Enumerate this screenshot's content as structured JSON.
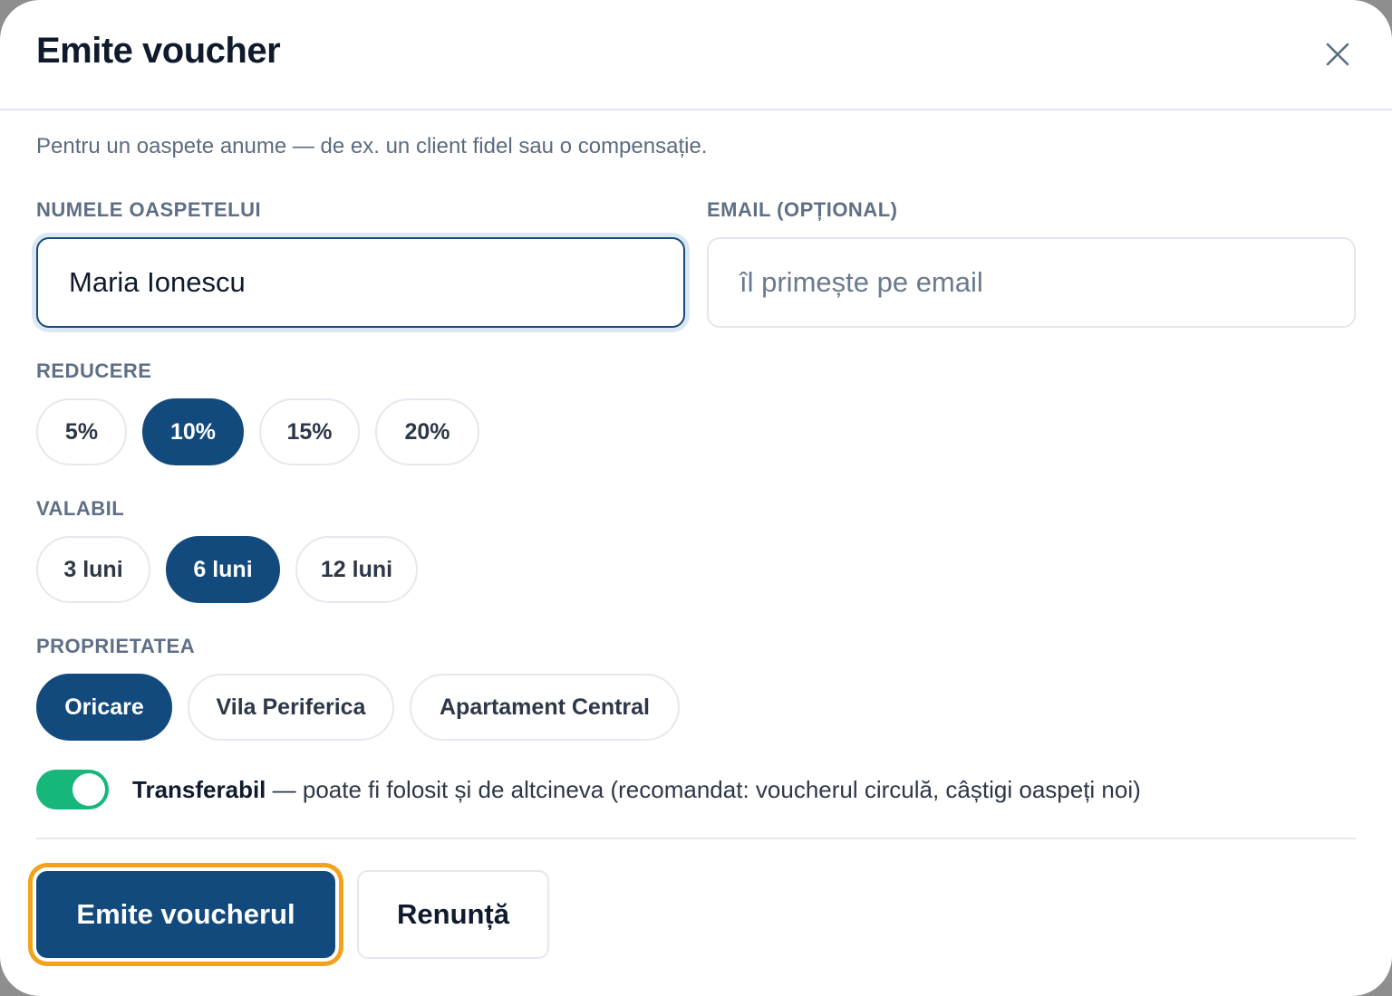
{
  "dialog": {
    "title": "Emite voucher",
    "subtitle": "Pentru un oaspete anume — de ex. un client fidel sau o compensație."
  },
  "fields": {
    "guest_name": {
      "label": "NUMELE OASPETELUI",
      "value": "Maria Ionescu"
    },
    "email": {
      "label": "EMAIL (OPȚIONAL)",
      "value": "",
      "placeholder": "îl primește pe email"
    }
  },
  "discount": {
    "label": "REDUCERE",
    "options": [
      "5%",
      "10%",
      "15%",
      "20%"
    ],
    "selected": "10%"
  },
  "validity": {
    "label": "VALABIL",
    "options": [
      "3 luni",
      "6 luni",
      "12 luni"
    ],
    "selected": "6 luni"
  },
  "property": {
    "label": "PROPRIETATEA",
    "options": [
      "Oricare",
      "Vila Periferica",
      "Apartament Central"
    ],
    "selected": "Oricare"
  },
  "transferable": {
    "enabled": true,
    "title": "Transferabil",
    "description": " — poate fi folosit și de altcineva (recomandat: voucherul circulă, câștigi oaspeți noi)"
  },
  "actions": {
    "primary_label": "Emite voucherul",
    "secondary_label": "Renunță"
  },
  "colors": {
    "primary": "#124a7d",
    "toggle_on": "#17b67b",
    "focus_ring": "#f3a21c"
  },
  "icons": {
    "close": "close-icon"
  }
}
